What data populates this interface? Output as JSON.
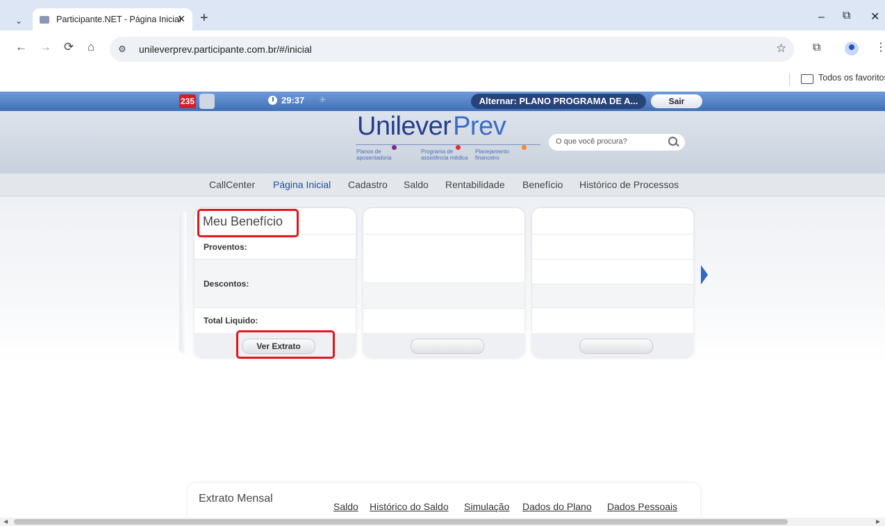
{
  "browser": {
    "tab_title": "Participante.NET - Página Inicial",
    "tab_close": "✕",
    "new_tab": "+",
    "url": "unileverprev.participante.com.br/#/inicial",
    "bookmarks_label": "Todos os favoritos",
    "window_controls": {
      "minimize": "–",
      "restore": "⧉",
      "close": "✕"
    },
    "nav": {
      "back": "←",
      "forward": "→",
      "reload": "⟳",
      "home": "⌂"
    }
  },
  "topbar": {
    "notification_count": "235",
    "timer": "29:37",
    "switch_plan": "Alternar: PLANO PROGRAMA DE A...",
    "logout": "Sair"
  },
  "brand": {
    "name_part1": "Unilever",
    "name_part2": "Prev",
    "taglines": [
      {
        "line1": "Planos de",
        "line2": "aposentadoria"
      },
      {
        "line1": "Programa de",
        "line2": "assistência médica"
      },
      {
        "line1": "Planejamento",
        "line2": "financeiro"
      }
    ],
    "search_placeholder": "O que você procura?"
  },
  "menu": {
    "items": [
      "CallCenter",
      "Página Inicial",
      "Cadastro",
      "Saldo",
      "Rentabilidade",
      "Benefício",
      "Histórico de Processos"
    ],
    "active": "Página Inicial"
  },
  "benefit_card": {
    "title": "Meu Benefício",
    "proventos_label": "Proventos:",
    "descontos_label": "Descontos:",
    "total_label": "Total Liquido:",
    "button": "Ver Extrato"
  },
  "extrato": {
    "title": "Extrato Mensal",
    "links": [
      "Saldo",
      "Histórico do Saldo",
      "Simulação",
      "Dados do Plano",
      "Dados Pessoais"
    ]
  },
  "colors": {
    "topbar": "#3f6fb6",
    "brand_blue": "#233e8b",
    "highlight": "#e3131c",
    "badge": "#d31f26"
  }
}
